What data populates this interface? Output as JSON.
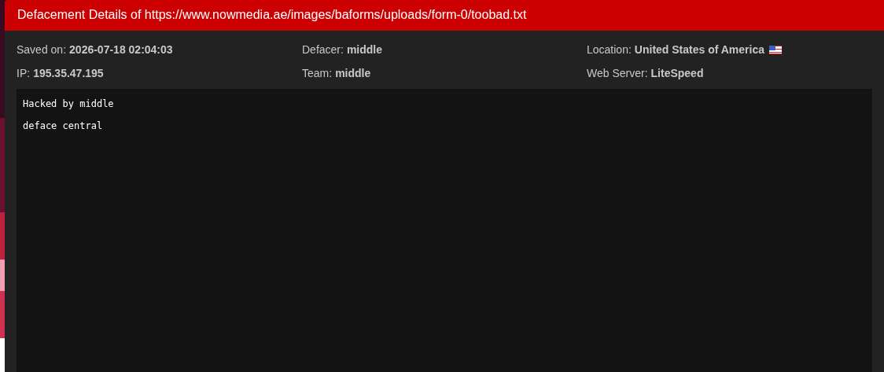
{
  "modal": {
    "title": "Defacement Details of https://www.nowmedia.ae/images/baforms/uploads/form-0/toobad.txt"
  },
  "details": [
    {
      "label": "Saved on:",
      "value": "2026-07-18 02:04:03",
      "kind": "text"
    },
    {
      "label": "Defacer:",
      "value": "middle",
      "kind": "text"
    },
    {
      "label": "Location:",
      "value": "United States of America",
      "kind": "country"
    },
    {
      "label": "IP:",
      "value": "195.35.47.195",
      "kind": "text"
    },
    {
      "label": "Team:",
      "value": "middle",
      "kind": "text"
    },
    {
      "label": "Web Server:",
      "value": "LiteSpeed",
      "kind": "text"
    }
  ],
  "content": {
    "lines": [
      "Hacked by middle",
      "deface central"
    ]
  }
}
